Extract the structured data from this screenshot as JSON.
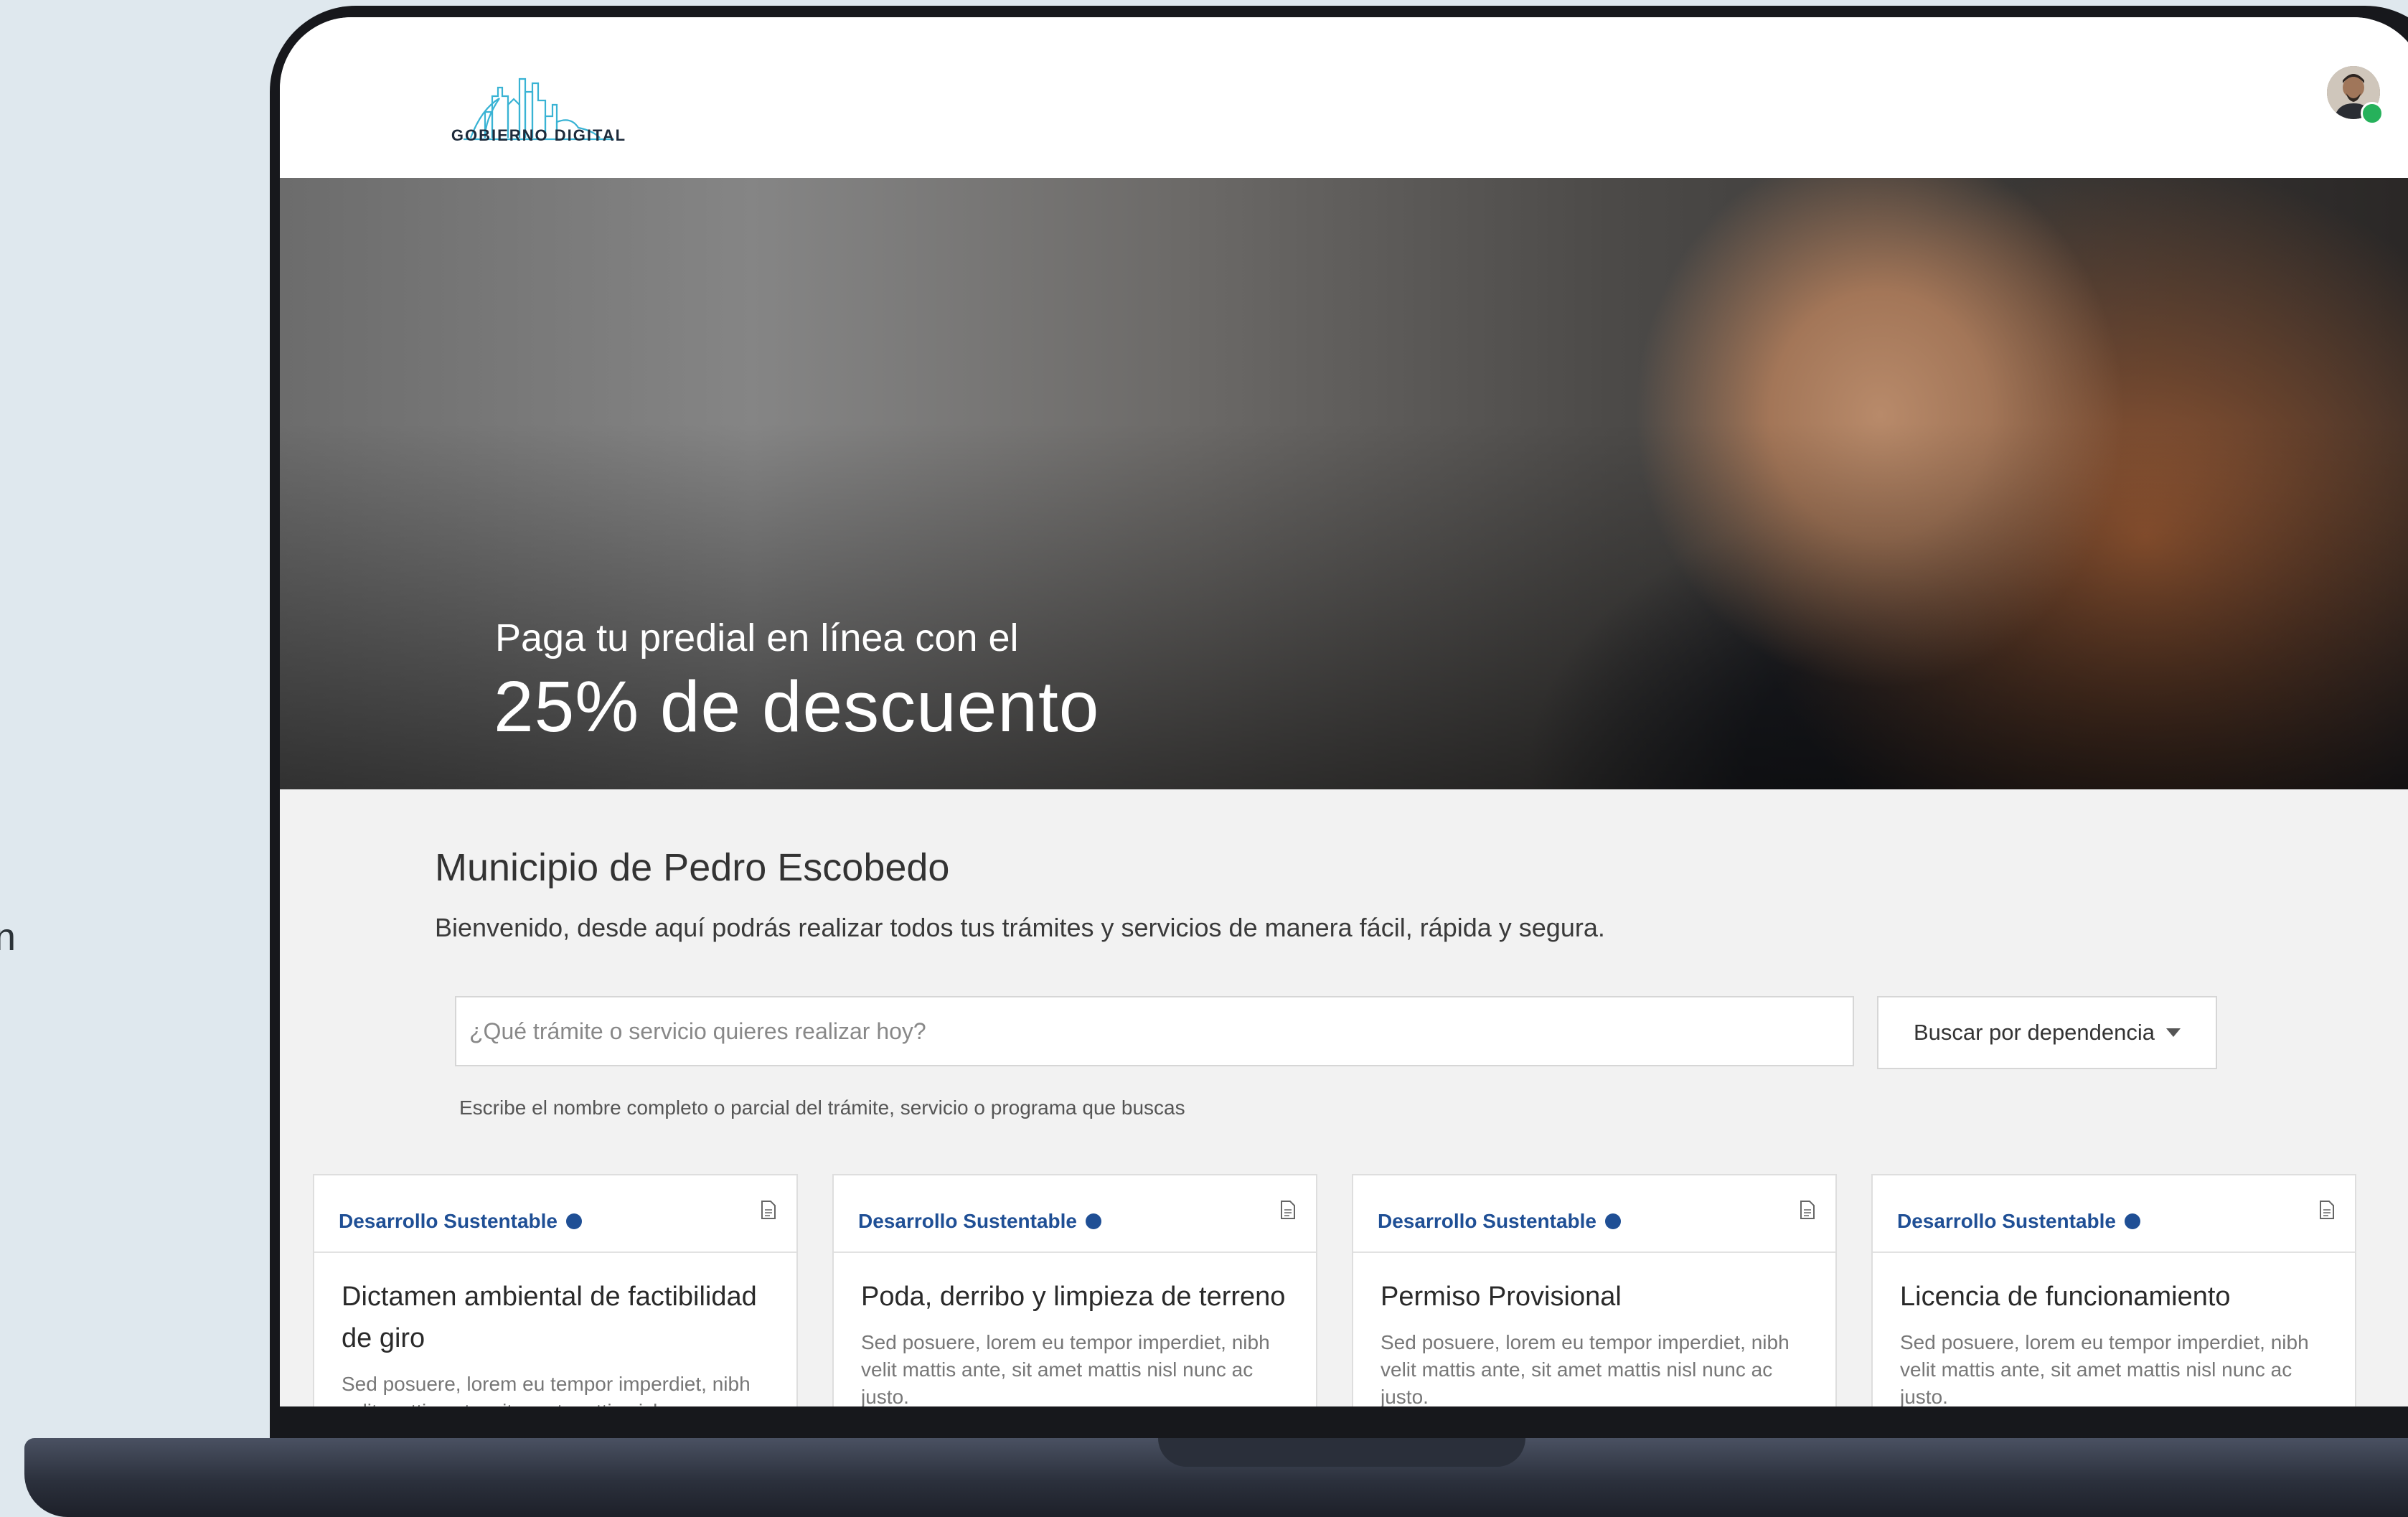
{
  "edge_text": "n",
  "header": {
    "logo_text": "GOBIERNO DIGITAL",
    "logo_icon": "city-skyline-icon",
    "avatar_icon": "user-avatar-icon",
    "status_color": "#26b15b"
  },
  "hero": {
    "subtitle": "Paga tu predial en línea con el",
    "title": "25% de descuento"
  },
  "main": {
    "title": "Municipio de Pedro Escobedo",
    "description": "Bienvenido, desde aquí podrás realizar todos tus trámites y servicios de manera fácil, rápida y segura."
  },
  "search": {
    "placeholder": "¿Qué trámite o servicio quieres realizar hoy?",
    "value": "",
    "helper": "Escribe el nombre completo o parcial del trámite, servicio o programa que buscas",
    "dependency_button": "Buscar por dependencia"
  },
  "cards": [
    {
      "category": "Desarrollo Sustentable",
      "title": "Dictamen ambiental de factibilidad de giro",
      "text": "Sed posuere, lorem eu tempor imperdiet, nibh velit mattis ante, sit amet mattis nisl"
    },
    {
      "category": "Desarrollo Sustentable",
      "title": "Poda, derribo y limpieza de terreno",
      "text": "Sed posuere, lorem eu tempor imperdiet, nibh velit mattis ante, sit amet mattis nisl nunc ac justo."
    },
    {
      "category": "Desarrollo Sustentable",
      "title": "Permiso Provisional",
      "text": "Sed posuere, lorem eu tempor imperdiet, nibh velit mattis ante, sit amet mattis nisl nunc ac justo."
    },
    {
      "category": "Desarrollo Sustentable",
      "title": "Licencia de funcionamiento",
      "text": "Sed posuere, lorem eu tempor imperdiet, nibh velit mattis ante, sit amet mattis nisl nunc ac justo."
    }
  ],
  "colors": {
    "accent": "#1f4f95",
    "background": "#dfe8ee"
  }
}
